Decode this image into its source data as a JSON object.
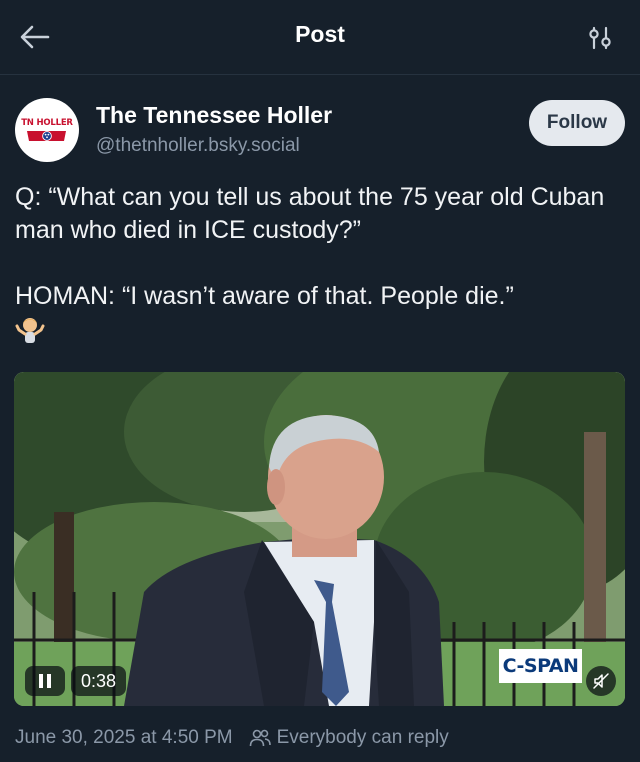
{
  "header": {
    "title": "Post",
    "back_icon": "back-arrow-icon",
    "filter_icon": "sliders-icon"
  },
  "author": {
    "display_name": "The Tennessee Holler",
    "handle": "@thetnholler.bsky.social",
    "avatar_text": "TN HOLLER",
    "follow_label": "Follow"
  },
  "post": {
    "line1": "Q: “What can you tell us about the 75 year old Cuban man who died in ICE custody?”",
    "line2": "HOMAN: “I wasn’t aware of that. People die.”",
    "emoji": "person-shrugging-emoji"
  },
  "video": {
    "duration": "0:38",
    "watermark": "C-SPAN",
    "play_state": "playing"
  },
  "meta": {
    "timestamp": "June 30, 2025 at 4:50 PM",
    "reply_setting": "Everybody can reply"
  },
  "colors": {
    "background": "#16202b",
    "muted_text": "#8b98a8",
    "follow_bg": "#e5e9ee"
  }
}
